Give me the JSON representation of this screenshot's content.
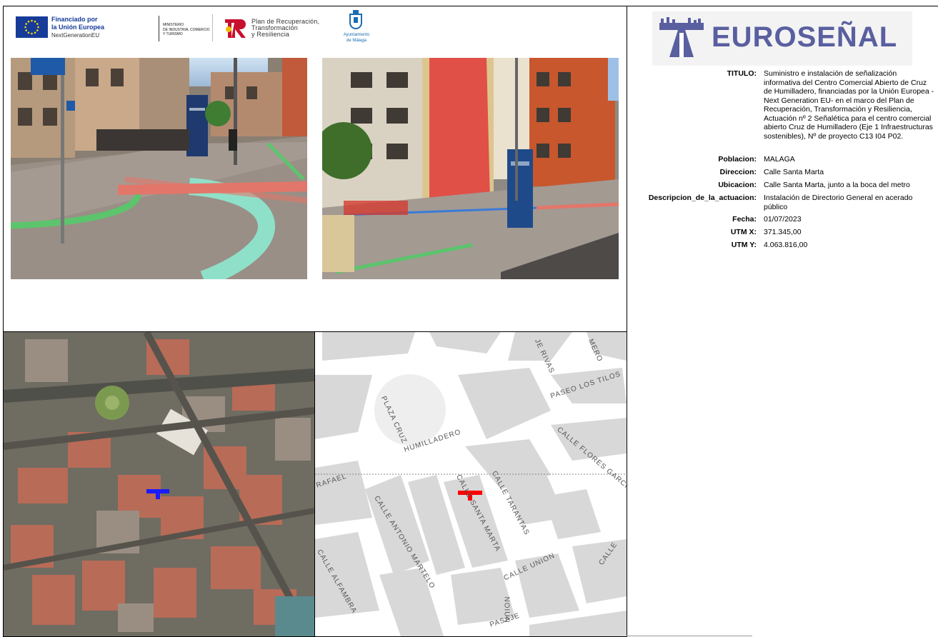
{
  "header": {
    "eu_line1": "Financiado por",
    "eu_line2": "la Unión Europea",
    "eu_line3": "NextGenerationEU",
    "ministry_line1": "MINISTERIO",
    "ministry_line2": "DE INDUSTRIA, COMERCIO",
    "ministry_line3": "Y TURISMO",
    "prtr_line1": "Plan de Recuperación,",
    "prtr_line2": "Transformación",
    "prtr_line3": "y Resiliencia",
    "city_line1": "Ayuntamiento",
    "city_line2": "de Málaga"
  },
  "logo": {
    "brand": "EUROSEÑAL",
    "color": "#5a5fa0"
  },
  "info": [
    {
      "label": "TITULO:",
      "value": "Suministro e instalación de señalización informativa del Centro Comercial Abierto de Cruz de Humilladero, financiadas por la Unión Europea -Next Generation EU- en el marco del Plan de Recuperación, Transformación y Resiliencia, Actuación nº 2 Señalética para el centro comercial abierto Cruz de Humilladero (Eje 1 Infraestructuras sostenibles), Nº de proyecto C13 I04 P02."
    },
    {
      "label": "Poblacion:",
      "value": "MALAGA"
    },
    {
      "label": "Direccion:",
      "value": "Calle Santa Marta"
    },
    {
      "label": "Ubicacion:",
      "value": " Calle Santa Marta, junto a la boca del metro"
    },
    {
      "label": "Descripcion_de_la_actuacion:",
      "value": "Instalación de Directorio General en acerado público"
    },
    {
      "label": "Fecha:",
      "value": "01/07/2023"
    },
    {
      "label": "UTM X:",
      "value": "371.345,00"
    },
    {
      "label": "UTM Y:",
      "value": "4.063.816,00"
    }
  ],
  "street_map_labels": [
    "PLAZA CRUZ",
    "HUMILLADERO",
    "PASEO LOS TILOS",
    "CALLE FLORES GARCIA",
    "CALLE SANTA MARTA",
    "CALLE TARANTAS",
    "CALLE ANTONIO MARTELO",
    "CALLE UNION",
    "CALLE ALFAMBRA",
    "RAFAEL",
    "JE RIVAS",
    "MERO",
    "CALLE",
    "PASAJE",
    "NOIUN"
  ],
  "colors": {
    "marker_aerial": "#1a1aff",
    "marker_street": "#ff0000",
    "eu_blue": "#163b99"
  }
}
